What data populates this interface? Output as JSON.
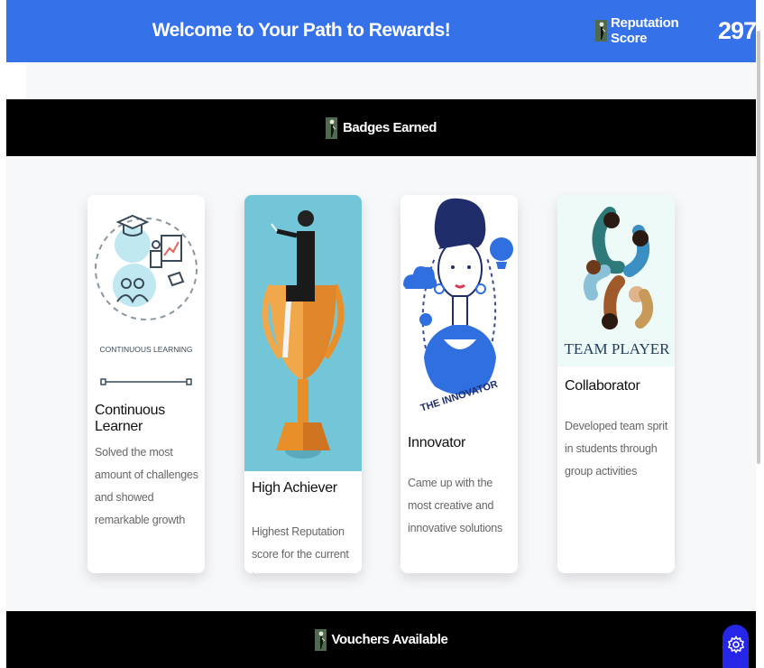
{
  "header": {
    "title": "Welcome to Your Path to Rewards!",
    "reputation_label": "Reputation Score",
    "reputation_score": "297"
  },
  "badges_section": {
    "title": "Badges Earned"
  },
  "badges": [
    {
      "title": "Continuous Learner",
      "description": "Solved the most amount of challenges and showed remarkable growth",
      "image_caption": "CONTINUOUS LEARNING"
    },
    {
      "title": "High Achiever",
      "description": "Highest Reputation score for the current tenure"
    },
    {
      "title": "Innovator",
      "description": "Came up with the most creative and innovative solutions",
      "image_caption": "THE INNOVATOR"
    },
    {
      "title": "Collaborator",
      "description": "Developed team sprit in students through group activities",
      "image_caption": "TEAM PLAYER"
    }
  ],
  "vouchers_section": {
    "title": "Vouchers Available"
  },
  "icons": {
    "section_icon": "person-figure-icon",
    "settings": "gear-icon"
  },
  "colors": {
    "header_bg": "#3571e8",
    "section_bar_bg": "#000000",
    "settings_fab_bg": "#2626e8"
  }
}
